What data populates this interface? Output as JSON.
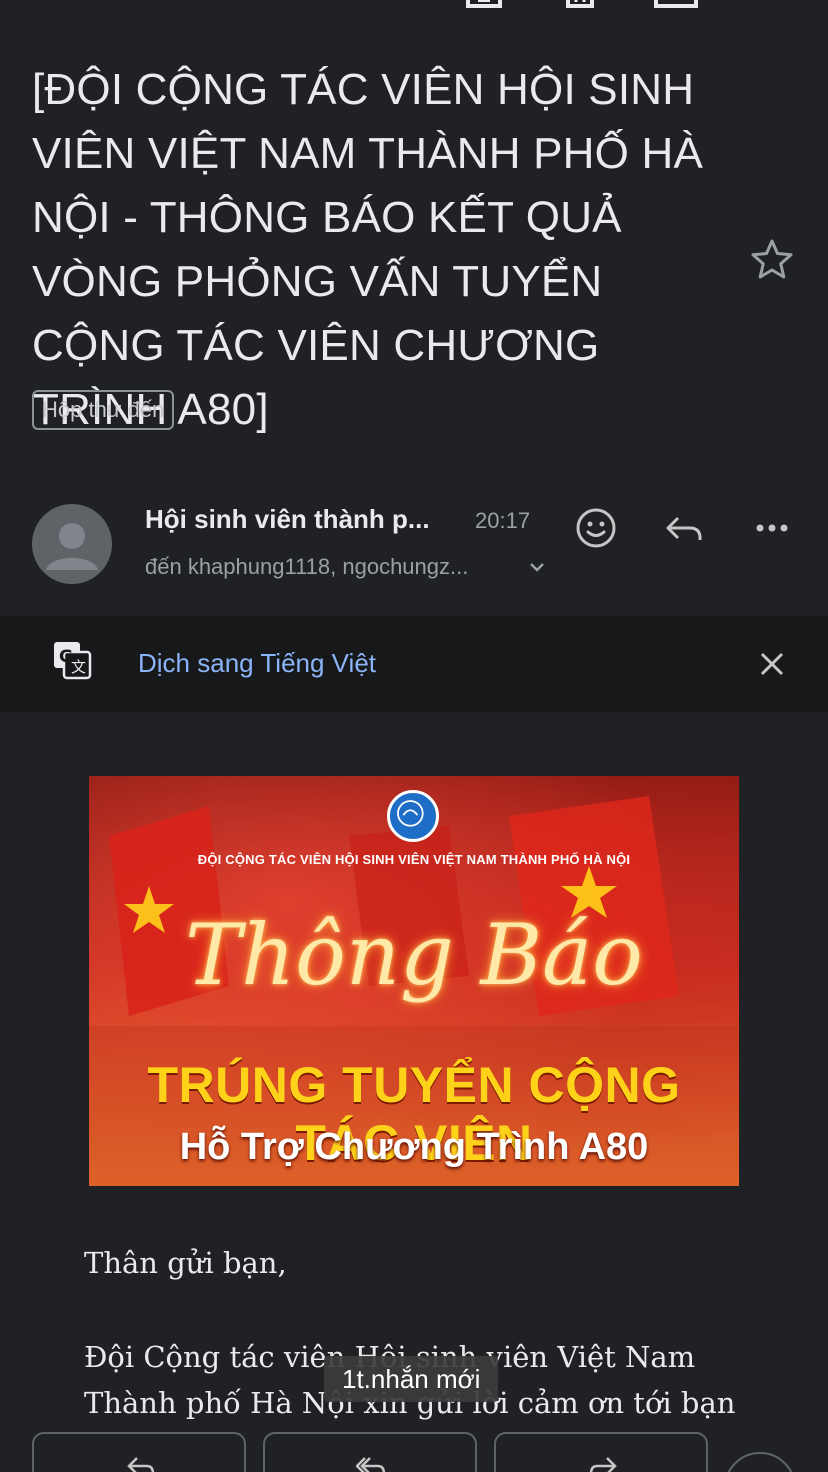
{
  "email": {
    "subject": "[ĐỘI CỘNG TÁC VIÊN HỘI SINH VIÊN VIỆT NAM THÀNH PHỐ HÀ NỘI - THÔNG BÁO KẾT QUẢ VÒNG PHỎNG VẤN TUYỂN CỘNG TÁC VIÊN CHƯƠNG TRÌNH A80]",
    "label": "Hộp thư đến",
    "sender": "Hội sinh viên thành p...",
    "time": "20:17",
    "recipients": "đến khaphung1118, ngochungz..."
  },
  "translate": {
    "link_text": "Dịch sang Tiếng Việt"
  },
  "banner": {
    "org": "ĐỘI CỘNG TÁC VIÊN HỘI SINH VIÊN VIỆT NAM THÀNH PHỐ HÀ NỘI",
    "script_title": "Thông Báo",
    "headline": "TRÚNG TUYỂN CỘNG TÁC VIÊN",
    "subheadline": "Hỗ Trợ Chương Trình A80"
  },
  "body": {
    "greeting": "Thân gửi bạn,",
    "paragraph": "Đội Cộng tác viên Hội sinh viên Việt Nam Thành phố Hà Nội xin gửi lời cảm ơn tới bạn vì đã đồng"
  },
  "toast": {
    "text": "1t.nhắn mới"
  },
  "colors": {
    "background": "#202124",
    "link": "#8ab4f8",
    "headline_yellow": "#ffd21a"
  }
}
